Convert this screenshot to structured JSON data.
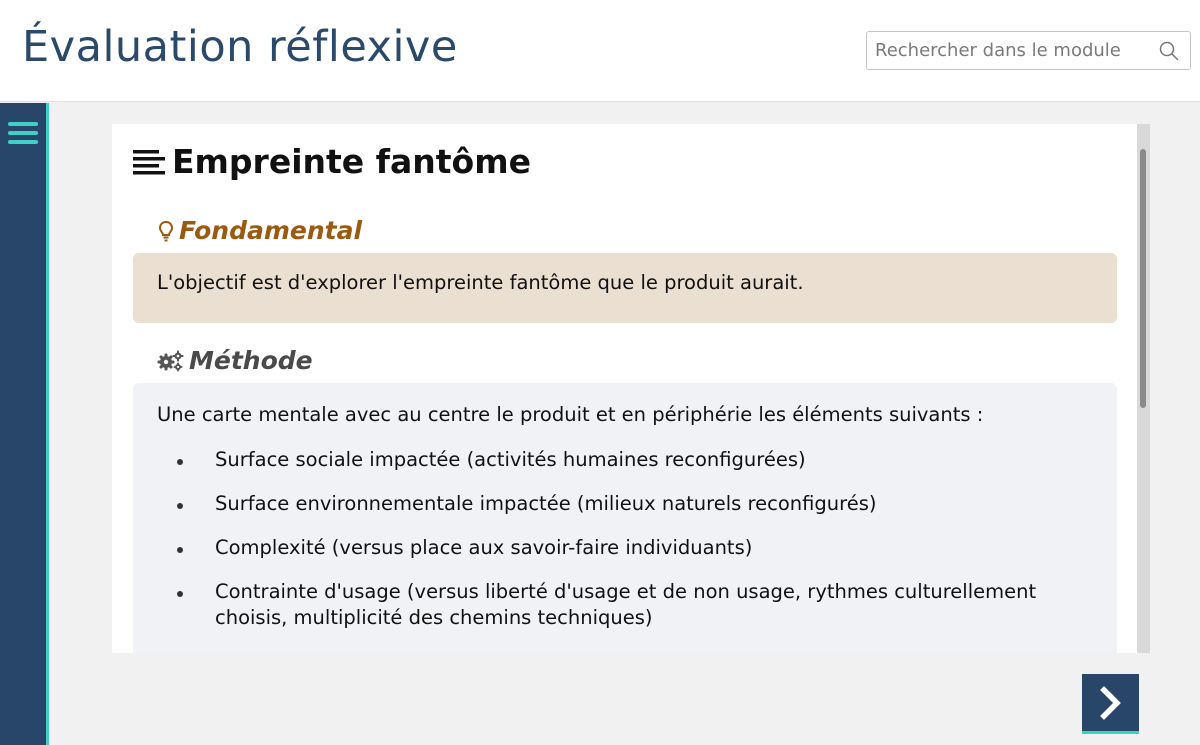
{
  "header": {
    "title": "Évaluation réflexive",
    "search": {
      "placeholder": "Rechercher dans le module",
      "value": "",
      "icon": "search-icon"
    }
  },
  "sidebar": {
    "menu_icon": "hamburger-menu-icon",
    "accent_color": "#3fd0c6",
    "background": "#27466a"
  },
  "content": {
    "section_title": "Empreinte fantôme",
    "section_icon": "text-lines-icon",
    "fundamental": {
      "icon": "lightbulb-icon",
      "heading": "Fondamental",
      "text": "L'objectif est d'explorer l'empreinte fantôme que le produit aurait.",
      "color": "#9a5a10",
      "background": "#eadfd0"
    },
    "methode": {
      "icon": "gears-icon",
      "heading": "Méthode",
      "intro": "Une carte mentale avec au centre le produit et en périphérie les éléments suivants :",
      "items": [
        "Surface sociale impactée (activités humaines reconfigurées)",
        "Surface environnementale impactée (milieux naturels reconfigurés)",
        "Complexité (versus place aux savoir-faire individuants)",
        "Contrainte d'usage (versus liberté d'usage et de non usage, rythmes culturellement choisis, multiplicité des chemins techniques)"
      ],
      "background": "#f1f2f6"
    }
  },
  "navigation": {
    "next_icon": "chevron-right-icon"
  }
}
